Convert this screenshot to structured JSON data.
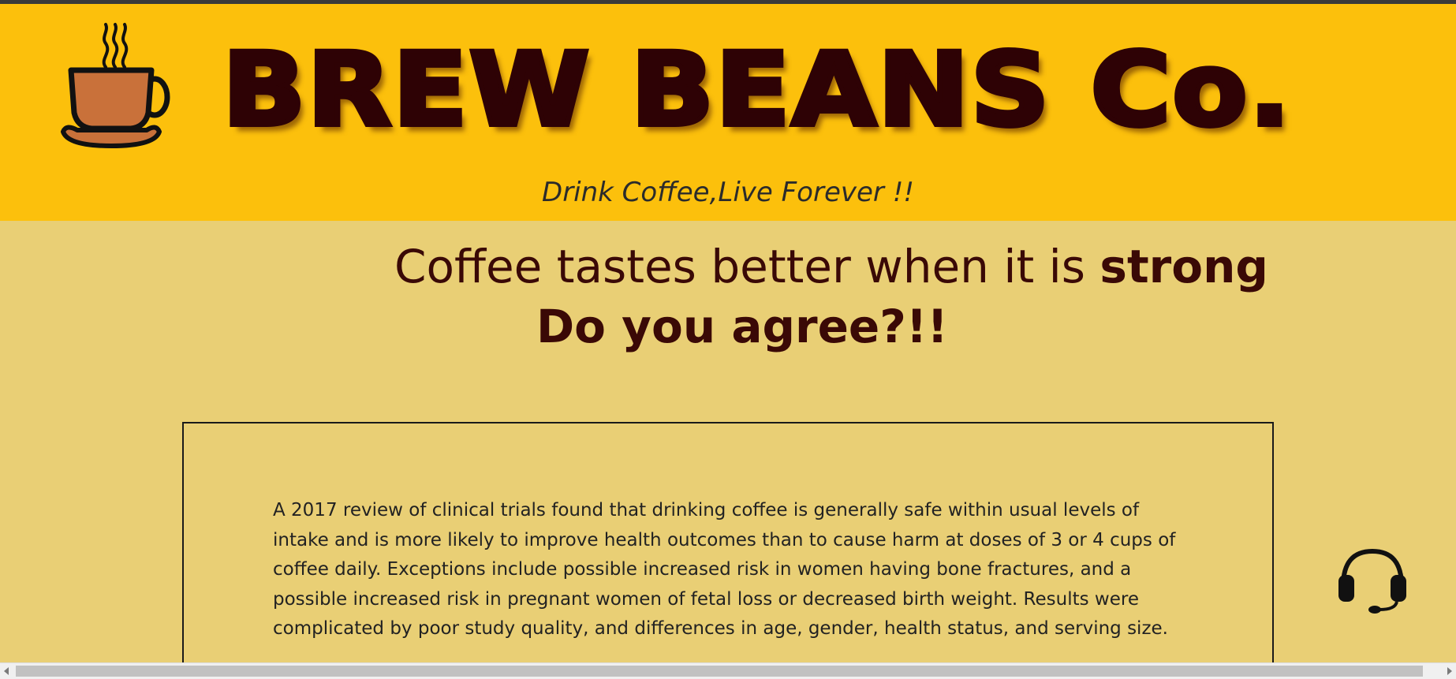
{
  "header": {
    "brand": "BREW BEANS Co.",
    "tagline": "Drink Coffee,Live Forever !!",
    "logo_icon": "coffee-cup-icon",
    "background": "#fcc00c",
    "brand_color": "#2e0205"
  },
  "hero": {
    "line1_prefix": "Coffee tastes better when it is ",
    "line1_emphasis": "strong",
    "line2": "Do you agree?!!"
  },
  "article": {
    "text": "A 2017 review of clinical trials found that drinking coffee is generally safe within usual levels of intake and is more likely to improve health outcomes than to cause harm at doses of 3 or 4 cups of coffee daily. Exceptions include possible increased risk in women having bone fractures, and a possible increased risk in pregnant women of fetal loss or decreased birth weight. Results were complicated by poor study quality, and differences in age, gender, health status, and serving size."
  },
  "support": {
    "icon": "headset-icon"
  },
  "colors": {
    "page_background": "#e9cf75",
    "text_dark": "#3a0906"
  }
}
